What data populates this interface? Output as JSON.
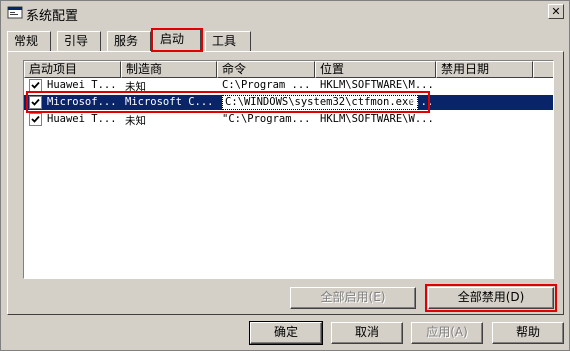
{
  "window": {
    "title": "系统配置",
    "close_glyph": "✕"
  },
  "tabs": [
    {
      "label": "常规"
    },
    {
      "label": "引导"
    },
    {
      "label": "服务"
    },
    {
      "label": "启动"
    },
    {
      "label": "工具"
    }
  ],
  "columns": [
    "启动项目",
    "制造商",
    "命令",
    "位置",
    "禁用日期"
  ],
  "rows": [
    {
      "checked": true,
      "name": "Huawei T...",
      "maker": "未知",
      "command": "C:\\Program ...",
      "location": "HKLM\\SOFTWARE\\M...",
      "date": ""
    },
    {
      "checked": true,
      "name": "Microsof...",
      "maker": "Microsoft C...",
      "command": "C:\\WINDOWS\\system32\\ctfmon.exe",
      "location": "M...",
      "date": "",
      "selected": true
    },
    {
      "checked": true,
      "name": "Huawei T...",
      "maker": "未知",
      "command": "\"C:\\Program...",
      "location": "HKLM\\SOFTWARE\\W...",
      "date": ""
    }
  ],
  "buttons": {
    "enable_all": "全部启用(E)",
    "disable_all": "全部禁用(D)",
    "ok": "确定",
    "cancel": "取消",
    "apply": "应用(A)",
    "help": "帮助"
  },
  "colors": {
    "highlight": "#e00000",
    "selection": "#0a246a"
  }
}
